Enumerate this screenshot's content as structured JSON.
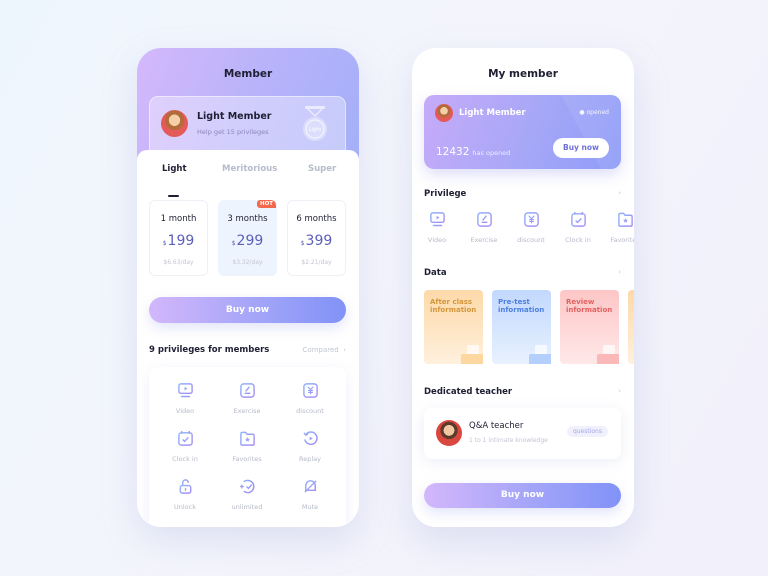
{
  "screen1": {
    "title": "Member",
    "member_card": {
      "name": "Light Member",
      "subtitle": "Help get 15 privileges",
      "medal_label": "Light"
    },
    "tabs": [
      {
        "label": "Light",
        "active": true
      },
      {
        "label": "Meritorious",
        "active": false
      },
      {
        "label": "Super",
        "active": false
      }
    ],
    "plans": [
      {
        "duration": "1 month",
        "currency": "$",
        "price": "199",
        "per_day": "$6.63/day",
        "selected": false,
        "badge": ""
      },
      {
        "duration": "3 months",
        "currency": "$",
        "price": "299",
        "per_day": "$3.32/day",
        "selected": true,
        "badge": "HOT"
      },
      {
        "duration": "6 months",
        "currency": "$",
        "price": "399",
        "per_day": "$2.21/day",
        "selected": false,
        "badge": ""
      }
    ],
    "buy_label": "Buy now",
    "privileges_title": "9 privileges for members",
    "compared_label": "Compared",
    "privileges": [
      {
        "label": "Video",
        "icon": "video-icon"
      },
      {
        "label": "Exercise",
        "icon": "exercise-icon"
      },
      {
        "label": "discount",
        "icon": "discount-icon"
      },
      {
        "label": "Clock in",
        "icon": "clock-in-icon"
      },
      {
        "label": "Favorites",
        "icon": "favorites-icon"
      },
      {
        "label": "Replay",
        "icon": "replay-icon"
      },
      {
        "label": "Unlock",
        "icon": "unlock-icon"
      },
      {
        "label": "unlimited",
        "icon": "unlimited-icon"
      },
      {
        "label": "Mute",
        "icon": "mute-icon"
      }
    ]
  },
  "screen2": {
    "title": "My member",
    "member_card": {
      "name": "Light Member",
      "status": "opened",
      "count": "12432",
      "count_label": "has opened",
      "buy_label": "Buy now"
    },
    "privilege_title": "Privilege",
    "privileges": [
      {
        "label": "Video"
      },
      {
        "label": "Exercise"
      },
      {
        "label": "discount"
      },
      {
        "label": "Clock in"
      },
      {
        "label": "Favorites"
      }
    ],
    "data_title": "Data",
    "data_cards": [
      {
        "label": "After class information",
        "color": "#d4963a"
      },
      {
        "label": "Pre-test information",
        "color": "#4c7fe0"
      },
      {
        "label": "Review information",
        "color": "#e06262"
      }
    ],
    "teacher_title": "Dedicated teacher",
    "teacher": {
      "name": "Q&A teacher",
      "subtitle": "1 to 1 intimate knowledge",
      "tag": "questions"
    },
    "buy_label": "Buy now"
  },
  "colors": {
    "accent": "#8e9cf8",
    "accent_light": "#d3b7fb",
    "hot": "#f4684e",
    "text": "#1e1f33"
  }
}
